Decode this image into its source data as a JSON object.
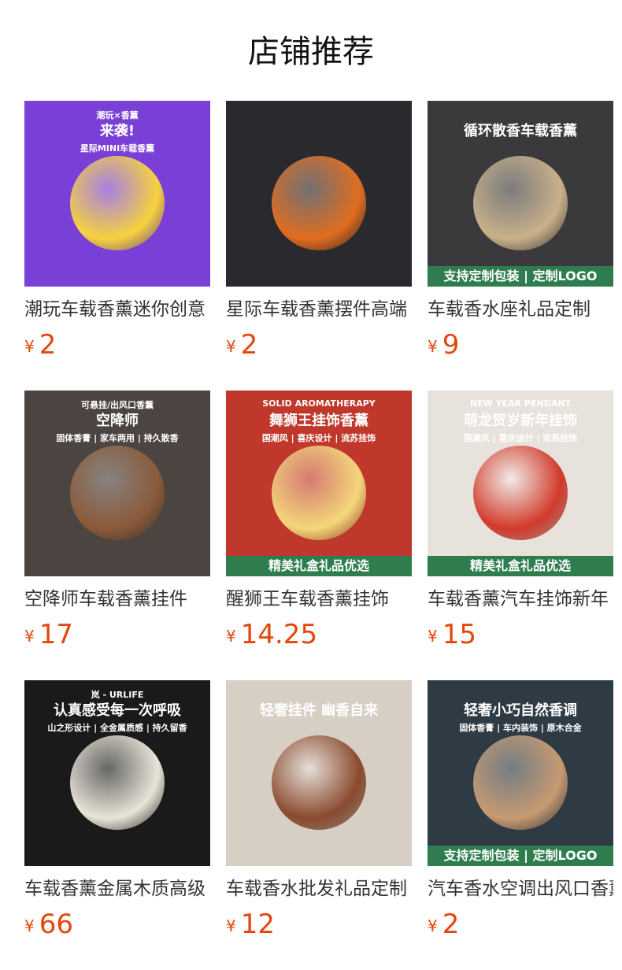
{
  "section_title": "店铺推荐",
  "currency_symbol": "¥",
  "products": [
    {
      "title": "潮玩车载香薰迷你创意",
      "price": "2",
      "image": {
        "bg": "#7a3fd6",
        "accent": "#f7d23e",
        "heading": "来袭!",
        "tag": "潮玩×香薰",
        "sub": "星际MINI车载香薰",
        "banner": "",
        "line1": "",
        "line2": ""
      }
    },
    {
      "title": "星际车载香薰摆件高端",
      "price": "2",
      "image": {
        "bg": "#2a2a2e",
        "accent": "#e06d1f",
        "heading": "",
        "tag": "",
        "sub": "",
        "banner": "",
        "line1": "",
        "line2": ""
      }
    },
    {
      "title": "车载香水座礼品定制",
      "price": "9",
      "image": {
        "bg": "#3a3a3c",
        "accent": "#c9b08a",
        "heading": "循环散香车载香薰",
        "tag": "",
        "sub": "",
        "banner": "支持定制包装 | 定制LOGO",
        "line1": "",
        "line2": ""
      }
    },
    {
      "title": "空降师车载香薰挂件",
      "price": "17",
      "image": {
        "bg": "#4b4440",
        "accent": "#8a5a3a",
        "heading": "空降师",
        "tag": "可悬挂/出风口香薰",
        "sub": "固体香膏 | 家车两用 | 持久散香",
        "banner": "",
        "line1": "",
        "line2": ""
      }
    },
    {
      "title": "醒狮王车载香薰挂饰",
      "price": "14.25",
      "image": {
        "bg": "#c0382b",
        "accent": "#f4d77a",
        "heading": "舞狮王挂饰香薰",
        "tag": "SOLID AROMATHERAPY",
        "sub": "国潮风 | 喜庆设计 | 流苏挂饰",
        "banner": "精美礼盒礼品优选",
        "line1": "",
        "line2": ""
      }
    },
    {
      "title": "车载香薰汽车挂饰新年",
      "price": "15",
      "image": {
        "bg": "#e8e2dc",
        "accent": "#d23a2a",
        "heading": "萌龙贺岁新年挂饰",
        "tag": "NEW YEAR PENDANT",
        "sub": "国潮风 | 喜庆设计 | 流苏挂饰",
        "banner": "精美礼盒礼品优选",
        "line1": "",
        "line2": ""
      }
    },
    {
      "title": "车载香薰金属木质高级",
      "price": "66",
      "image": {
        "bg": "#1a1a1a",
        "accent": "#e9e4d8",
        "heading": "认真感受每一次呼吸",
        "tag": "岚 - URLIFE",
        "sub": "山之形设计 | 全金属质感 | 持久留香",
        "banner": "",
        "line1": "",
        "line2": ""
      }
    },
    {
      "title": "车载香水批发礼品定制",
      "price": "12",
      "image": {
        "bg": "#d8cfc4",
        "accent": "#8a4a2e",
        "heading": "轻奢挂件 幽香自来",
        "tag": "",
        "sub": "",
        "banner": "",
        "line1": "",
        "line2": ""
      }
    },
    {
      "title": "汽车香水空调出风口香薰",
      "price": "2",
      "image": {
        "bg": "#2e3b45",
        "accent": "#c79a72",
        "heading": "轻奢小巧自然香调",
        "tag": "",
        "sub": "固体香膏 | 车内装饰 | 原木合金",
        "banner": "支持定制包装 | 定制LOGO",
        "line1": "",
        "line2": ""
      }
    }
  ]
}
